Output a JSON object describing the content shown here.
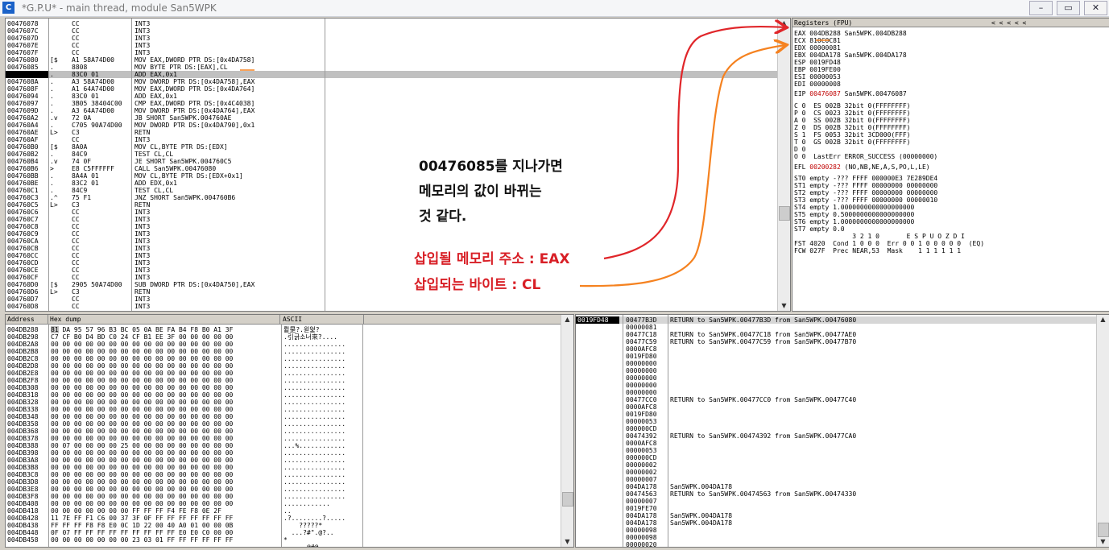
{
  "window": {
    "icon_letter": "C",
    "title": "*G.P.U* - main thread, module San5WPK",
    "min": "–",
    "max": "▭",
    "close": "✕"
  },
  "cpu": {
    "addresses": "00476078\n0047607C\n0047607D\n0047607E\n0047607F\n00476080\n00476085\n00476087\n0047608A\n0047608F\n00476094\n00476097\n0047609D\n004760A2\n004760A4\n004760AE\n004760AF\n004760B0\n004760B2\n004760B4\n004760B6\n004760BB\n004760BE\n004760C1\n004760C3\n004760C5\n004760C6\n004760C7\n004760C8\n004760C9\n004760CA\n004760CB\n004760CC\n004760CD\n004760CE\n004760CF\n004760D0\n004760D6\n004760D7\n004760D8",
    "markers": "\n\n\n\n\n[$\n.\n.\n.\n.\n.\n.\n.\n.v\n.\nL>\n\n[$\n.\n.v\n>\n.\n.\n.\n.^\nL>\n\n\n\n\n\n\n\n\n\n\n[$\nL>\n\n",
    "hex": "CC\nCC\nCC\nCC\nCC\nA1 58A74D00\n8808\n83C0 01\nA3 58A74D00\nA1 64A74D00\n83C0 01\n3B05 38404C00\nA3 64A74D00\n72 0A\nC705 90A74D00\nC3\nCC\n8A0A\n84C9\n74 0F\nE8 C5FFFFFF\n8A4A 01\n83C2 01\n84C9\n75 F1\nC3\nCC\nCC\nCC\nCC\nCC\nCC\nCC\nCC\nCC\nCC\n2905 50A74D00\nC3\nCC\nCC",
    "disasm": "INT3\nINT3\nINT3\nINT3\nINT3\nMOV EAX,DWORD PTR DS:[0x4DA758]\nMOV BYTE PTR DS:[EAX],CL\nADD EAX,0x1\nMOV DWORD PTR DS:[0x4DA758],EAX\nMOV EAX,DWORD PTR DS:[0x4DA764]\nADD EAX,0x1\nCMP EAX,DWORD PTR DS:[0x4C4038]\nMOV DWORD PTR DS:[0x4DA764],EAX\nJB SHORT San5WPK.004760AE\nMOV DWORD PTR DS:[0x4DA790],0x1\nRETN\nINT3\nMOV CL,BYTE PTR DS:[EDX]\nTEST CL,CL\nJE SHORT San5WPK.004760C5\nCALL San5WPK.00476080\nMOV CL,BYTE PTR DS:[EDX+0x1]\nADD EDX,0x1\nTEST CL,CL\nJNZ SHORT San5WPK.004760B6\nRETN\nINT3\nINT3\nINT3\nINT3\nINT3\nINT3\nINT3\nINT3\nINT3\nINT3\nSUB DWORD PTR DS:[0x4DA750],EAX\nRETN\nINT3\nINT3",
    "scroll_up": "▲",
    "scroll_down": "▼"
  },
  "registers": {
    "header": "Registers (FPU)",
    "nav": "<    <    <    <    <",
    "general": "EAX 004DB288 San5WPK.004DB288\nECX 810C0C81\nEDX 00000081\nEBX 004DA178 San5WPK.004DA178\nESP 0019FD48\nEBP 0019FE00\nESI 00000053\nEDI 00000008",
    "eip_label": "EIP",
    "eip_value": "00476087",
    "eip_sym": "San5WPK.00476087",
    "flags": "C 0  ES 002B 32bit 0(FFFFFFFF)\nP 0  CS 0023 32bit 0(FFFFFFFF)\nA 0  SS 002B 32bit 0(FFFFFFFF)\nZ 0  DS 002B 32bit 0(FFFFFFFF)\nS 1  FS 0053 32bit 3CD000(FFF)\nT 0  GS 002B 32bit 0(FFFFFFFF)\nD 0\nO 0  LastErr ERROR_SUCCESS (00000000)",
    "efl_label": "EFL",
    "efl_value": "00200282",
    "efl_flags": "(NO,NB,NE,A,S,PO,L,LE)",
    "fpu": "ST0 empty -??? FFFF 000000E3 7E289DE4\nST1 empty -??? FFFF 00000000 00000000\nST2 empty -??? FFFF 00000000 00000000\nST3 empty -??? FFFF 00000000 00000010\nST4 empty 1.0000000000000000000\nST5 empty 0.5000000000000000000\nST6 empty 1.0000000000000000000\nST7 empty 0.0\n               3 2 1 0       E S P U O Z D I\nFST 4020  Cond 1 0 0 0  Err 0 0 1 0 0 0 0 0  (EQ)\nFCW 027F  Prec NEAR,53  Mask    1 1 1 1 1 1"
  },
  "dump": {
    "header_address": "Address",
    "header_hex": "Hex dump",
    "header_ascii": "ASCII",
    "addresses": "004DB288\n004DB298\n004DB2A8\n004DB2B8\n004DB2C8\n004DB2D8\n004DB2E8\n004DB2F8\n004DB308\n004DB318\n004DB328\n004DB338\n004DB348\n004DB358\n004DB368\n004DB378\n004DB388\n004DB398\n004DB3A8\n004DB3B8\n004DB3C8\n004DB3D8\n004DB3E8\n004DB3F8\n004DB408\n004DB418\n004DB428\n004DB438\n004DB448\n004DB458",
    "hex_first_byte": "81",
    "hex_first_rest": " DA 95 57 96 B3 BC 05 0A BE FA B4 F8 B0 A1 3F",
    "hex_rest": "C7 CF B0 D4 BD C0 24 CF B1 EE 3F 00 00 00 00 00\n00 00 00 00 00 00 00 00 00 00 00 00 00 00 00 00\n00 00 00 00 00 00 00 00 00 00 00 00 00 00 00 00\n00 00 00 00 00 00 00 00 00 00 00 00 00 00 00 00\n00 00 00 00 00 00 00 00 00 00 00 00 00 00 00 00\n00 00 00 00 00 00 00 00 00 00 00 00 00 00 00 00\n00 00 00 00 00 00 00 00 00 00 00 00 00 00 00 00\n00 00 00 00 00 00 00 00 00 00 00 00 00 00 00 00\n00 00 00 00 00 00 00 00 00 00 00 00 00 00 00 00\n00 00 00 00 00 00 00 00 00 00 00 00 00 00 00 00\n00 00 00 00 00 00 00 00 00 00 00 00 00 00 00 00\n00 00 00 00 00 00 00 00 00 00 00 00 00 00 00 00\n00 00 00 00 00 00 00 00 00 00 00 00 00 00 00 00\n00 00 00 00 00 00 00 00 00 00 00 00 00 00 00 00\n00 00 00 00 00 00 00 00 00 00 00 00 00 00 00 00\n00 07 00 00 00 00 25 00 00 00 00 00 00 00 00 00\n00 00 00 00 00 00 00 00 00 00 00 00 00 00 00 00\n00 00 00 00 00 00 00 00 00 00 00 00 00 00 00 00\n00 00 00 00 00 00 00 00 00 00 00 00 00 00 00 00\n00 00 00 00 00 00 00 00 00 00 00 00 00 00 00 00\n00 00 00 00 00 00 00 00 00 00 00 00 00 00 00 00\n00 00 00 00 00 00 00 00 00 00 00 00 00 00 00 00\n00 00 00 00 00 00 00 00 00 00 00 00 00 00 00 00\n00 00 00 00 00 00 00 00 00 00 00 00 00 00 00 00\n00 00 00 00 00 00 00 FF FF FF F4 FE F8 0E 2F\n11 7E FF F1 C6 00 37 3F 0F FF FF FF FF FF FF FF\nFF FF FF F8 F8 E0 0C 1D 22 00 40 A0 01 00 00 0B\n0F 07 FF FF FF FF FF FF FF FF FF E0 E0 C0 00 00\n00 00 00 00 00 00 00 23 03 01 FF FF FF FF FF FF",
    "ascii": "륕昰?.왿엁?\n.引긁소너來?....\n................\n................\n................\n................\n................\n................\n................\n................\n................\n................\n................\n................\n................\n................\n...%............\n................\n................\n................\n................\n................\n................\n................\n............\n..\n.?........?.....\n    ?????*\n  ...?#\".@?..\n*\n  ....@#@",
    "scroll_up": "▲",
    "scroll_down": "▼"
  },
  "stack": {
    "addresses": "0019FD48\n0019FD4C\n0019FD50\n0019FD54\n0019FD58\n0019FD5C\n0019FD60\n0019FD64\n0019FD68\n0019FD6C\n0019FD70\n0019FD74\n0019FD78\n0019FD7C\n0019FD80\n0019FD84\n0019FD88\n0019FD8C\n0019FD90\n0019FD94\n0019FD98\n0019FD9C\n0019FDA0\n0019FDA4\n0019FDA8\n0019FDAC\n0019FDB0\n0019FDB4\n0019FDB8\n0019FDBC\n0019FDC0\n0019FDC4",
    "values": "00477B3D\n00000081\n00477C18\n00477C59\n0000AFC8\n0019FD80\n00000000\n00000000\n00000000\n00000000\n00000000\n00477CC0\n0000AFC8\n0019FD80\n00000053\n000000CD\n00474392\n0000AFC8\n00000053\n000000CD\n00000002\n00000002\n00000007\n004DA178\n00474563\n00000007\n0019FE70\n004DA178\n004DA178\n00000098\n00000098\n00000020",
    "comments": "RETURN to San5WPK.00477B3D from San5WPK.00476080\n\nRETURN to San5WPK.00477C18 from San5WPK.00477AE0\nRETURN to San5WPK.00477C59 from San5WPK.00477B70\n\n\n\n\n\n\n\nRETURN to San5WPK.00477CC0 from San5WPK.00477C40\n\n\n\n\nRETURN to San5WPK.00474392 from San5WPK.00477CA0\n\n\n\n\n\n\nSan5WPK.004DA178\nRETURN to San5WPK.00474563 from San5WPK.00474330\n\n\nSan5WPK.004DA178\nSan5WPK.004DA178\n\n\n",
    "scroll_up": "▲",
    "scroll_down": "▼"
  },
  "annotations": {
    "line1": "00476085를 지나가면",
    "line2": "메모리의 값이 바뀌는",
    "line3": "것 같다.",
    "eax_note": "삽입될 메모리 주소 : EAX",
    "cl_note": "삽입되는 바이트 : CL",
    "red_color": "#e0262a",
    "orange_color": "#f58220"
  }
}
